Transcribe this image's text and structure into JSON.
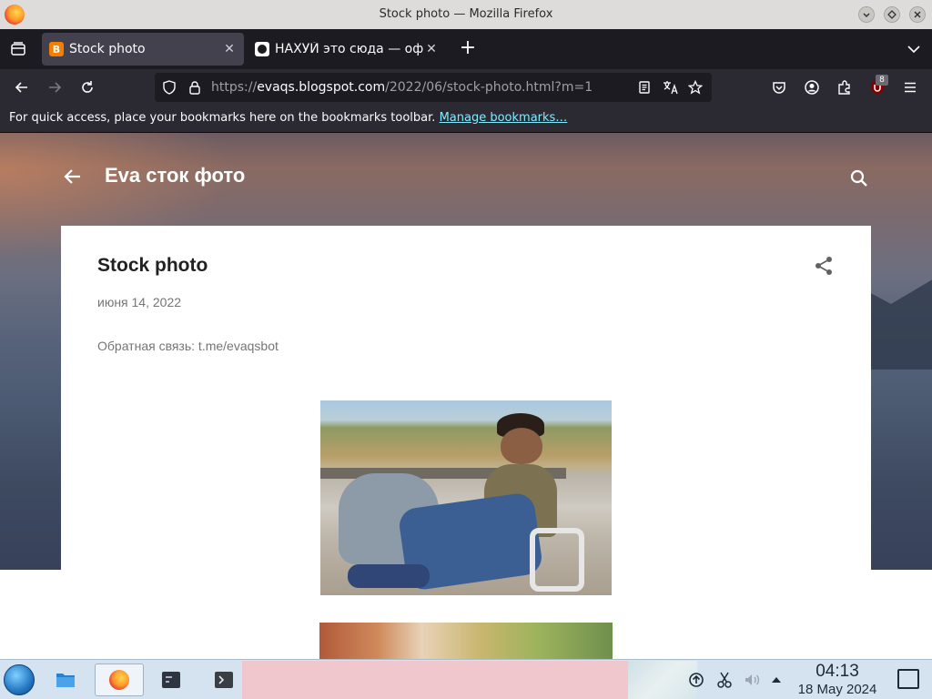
{
  "window": {
    "title": "Stock photo — Mozilla Firefox"
  },
  "tabs": [
    {
      "label": "Stock photo",
      "active": true,
      "icon": "blogger-icon"
    },
    {
      "label": "НАХУЙ это сюда — офи",
      "active": false,
      "icon": "site-icon"
    }
  ],
  "navbar": {
    "url_scheme": "https://",
    "url_host": "evaqs.blogspot.com",
    "url_path": "/2022/06/stock-photo.html?m=1",
    "extension_badge": "8"
  },
  "bookmarks_bar": {
    "message": "For quick access, place your bookmarks here on the bookmarks toolbar.",
    "link_label": "Manage bookmarks…"
  },
  "blog": {
    "title": "Eva сток фото"
  },
  "post": {
    "title": "Stock photo",
    "date": "июня 14, 2022",
    "body": "Обратная связь: t.me/evaqsbot"
  },
  "taskbar": {
    "time": "04:13",
    "date": "18 May 2024"
  },
  "colors": {
    "accent_link": "#80ebff",
    "tab_active_bg": "#42414d",
    "toolbar_bg": "#2b2a33"
  }
}
